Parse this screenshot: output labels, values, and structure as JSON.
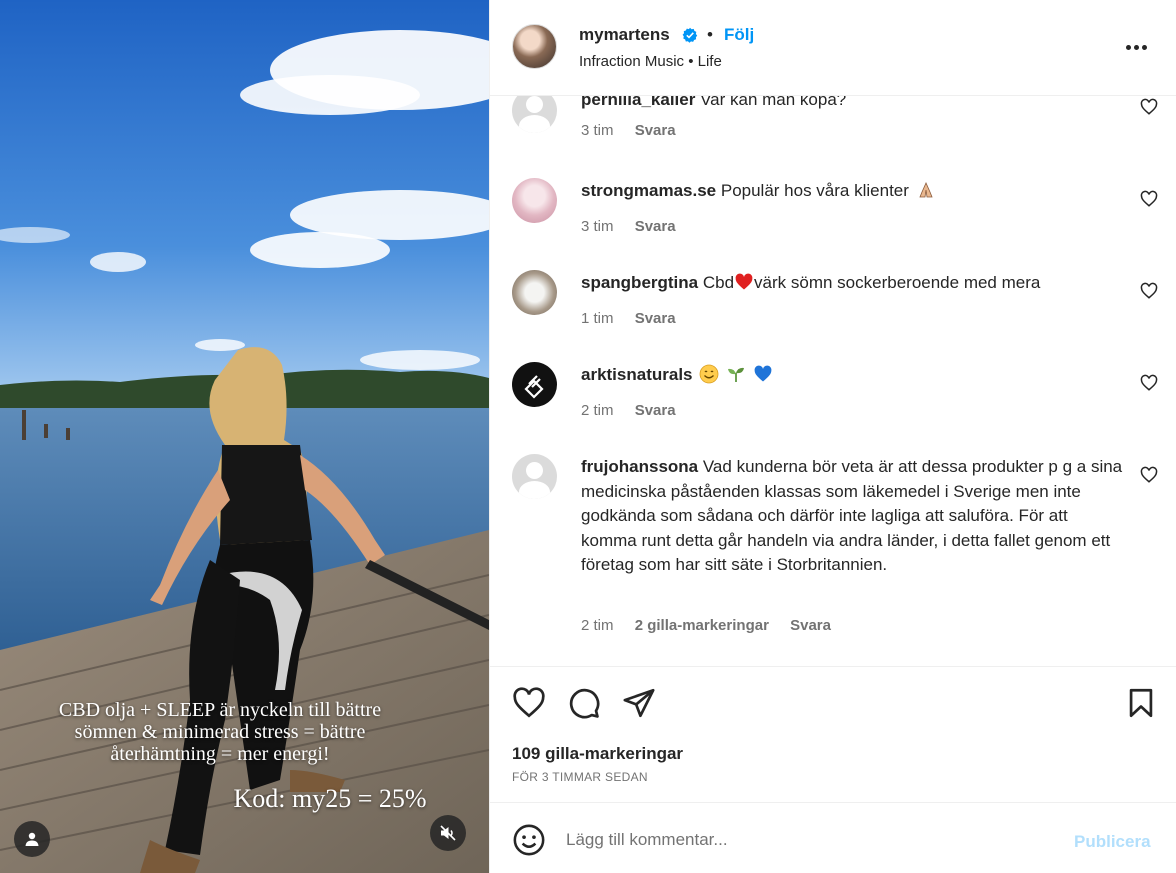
{
  "media": {
    "overlay_line1": "CBD olja + SLEEP är nyckeln till bättre",
    "overlay_line2": "sömnen & minimerad stress = bättre",
    "overlay_line3": "återhämtning = mer energi!",
    "overlay_code": "Kod: my25 = 25%"
  },
  "header": {
    "username": "mymartens",
    "separator": "•",
    "follow_label": "Följ",
    "subtitle": "Infraction Music • Life"
  },
  "comments": [
    {
      "user": "pernilla_kaller",
      "text": "Var kan man köpa?",
      "time": "3 tim",
      "reply": "Svara",
      "likes": ""
    },
    {
      "user": "strongmamas.se",
      "text": "Populär hos våra klienter",
      "emoji": "folded-hands",
      "time": "3 tim",
      "reply": "Svara",
      "likes": ""
    },
    {
      "user": "spangbergtina",
      "text_pre": "Cbd",
      "emoji": "red-heart",
      "text": "värk sömn sockerberoende med mera",
      "time": "1 tim",
      "reply": "Svara",
      "likes": ""
    },
    {
      "user": "arktisnaturals",
      "emoji_list": [
        "smiling-face",
        "seedling",
        "blue-heart"
      ],
      "time": "2 tim",
      "reply": "Svara",
      "likes": ""
    },
    {
      "user": "frujohanssona",
      "text": "Vad kunderna bör veta är att dessa produkter p g a sina medicinska påståenden klassas som läkemedel i Sverige men inte godkända som sådana och därför inte lagliga att saluföra. För att komma runt detta går handeln via andra länder, i detta fallet genom ett företag som har sitt säte i Storbritannien.",
      "time": "2 tim",
      "reply": "Svara",
      "likes": "2 gilla-markeringar"
    }
  ],
  "actions": {
    "likes_count": "109 gilla-markeringar",
    "time_ago": "FÖR 3 TIMMAR SEDAN"
  },
  "composer": {
    "placeholder": "Lägg till kommentar...",
    "publish_label": "Publicera"
  },
  "colors": {
    "link_blue": "#0095f6",
    "publish_disabled": "#b2dffc",
    "muted_text": "#737373",
    "verified_blue": "#0095f6"
  }
}
